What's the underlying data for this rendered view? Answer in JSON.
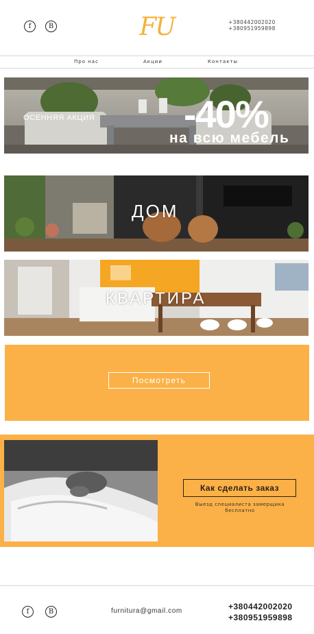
{
  "header": {
    "social": {
      "facebook": "f",
      "vk": "B"
    },
    "logo": "FU",
    "phones": [
      "+380442002020",
      "+380951959898"
    ]
  },
  "nav": {
    "items": [
      "Про нас",
      "Акции",
      "Контакты"
    ]
  },
  "promo_banner": {
    "label": "ОСЕННЯЯ АКЦИЯ",
    "discount": "-40%",
    "subtitle": "на всю мебель"
  },
  "categories": [
    {
      "title": "ДОМ"
    },
    {
      "title": "КВАРТИРА"
    }
  ],
  "view_section": {
    "button": "Посмотреть"
  },
  "order_section": {
    "button": "Как сделать заказ",
    "note": "Выезд специалиста замерщика бесплатно"
  },
  "footer": {
    "social": {
      "facebook": "f",
      "vk": "B"
    },
    "email": "furnitura@gmail.com",
    "phones": [
      "+380442002020",
      "+380951959898"
    ]
  },
  "colors": {
    "accent": "#fbb147",
    "logo": "#f6b23c",
    "text": "#222222"
  }
}
